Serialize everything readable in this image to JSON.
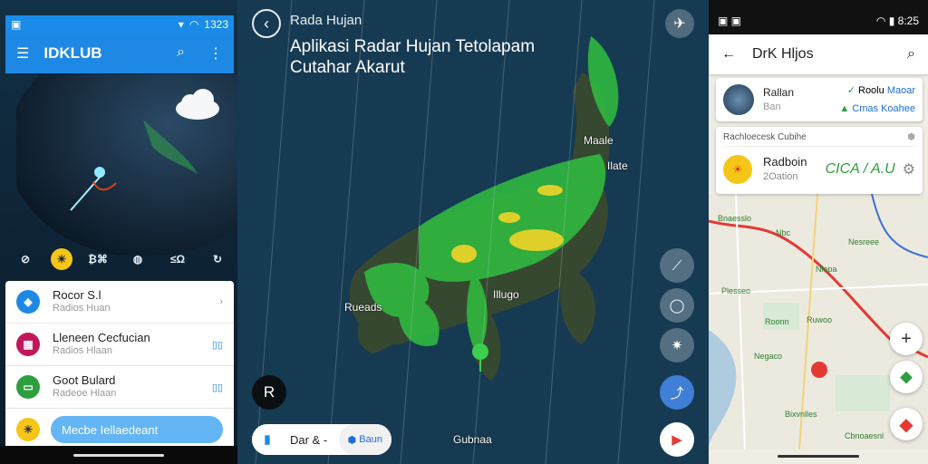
{
  "screen1": {
    "status": {
      "time": "1323"
    },
    "app_title": "IDKLUB",
    "icons_row": [
      "no-rain-icon",
      "sun-icon",
      "stats-icon",
      "globe-icon",
      "wind-icon",
      "rotate-icon"
    ],
    "icon_texts": {
      "stats": "₿⌘",
      "wind": "≤Ω"
    },
    "list": [
      {
        "title": "Rocor S.l",
        "subtitle": "Radios Huan",
        "color": "#1e88e5",
        "icon": "location-icon"
      },
      {
        "title": "Lleneen Cecfucian",
        "subtitle": "Radios Hlaan",
        "color": "#c2185b",
        "icon": "map-icon",
        "end": "▯▯"
      },
      {
        "title": "Goot Bulard",
        "subtitle": "Radeoe Hlaan",
        "color": "#2e9e3e",
        "icon": "tv-icon",
        "end": "▯▯"
      }
    ],
    "action_pill": "Mecbe Iellaedeant"
  },
  "screen2": {
    "small_title": "Rada Hujan",
    "big_title": "Aplikasi Radar Hujan Tetolapam Cutahar Akarut",
    "map_labels": [
      {
        "text": "Maale"
      },
      {
        "text": "Ilate"
      },
      {
        "text": "Rueads"
      },
      {
        "text": "Illugo"
      },
      {
        "text": "Gubnaa"
      }
    ],
    "bottom_bar": {
      "mid": "Dar & -",
      "seg": "Baun"
    },
    "black_fab": "R"
  },
  "screen3": {
    "status": {
      "time": "8:25"
    },
    "title": "DrK Hljos",
    "card1": {
      "name": "Rallan",
      "sub": "Ban",
      "r1a": "Roolu",
      "r1b": "Maoar",
      "r2a": "Cmas",
      "r2b": "Koahee"
    },
    "card2": {
      "header": "Rachloecesk Cubihe",
      "name": "Radboin",
      "sub": "2Oation",
      "temp": "CICA  / A.U"
    },
    "map_labels": [
      "Bnaesslo",
      "Nbc",
      "Nesreee",
      "Nlopa",
      "Plesseo",
      "Roonn",
      "Ruwoo",
      "Negaco",
      "Bixvnlles",
      "Cbnoaesnl"
    ]
  },
  "colors": {
    "primary": "#1e88e5",
    "radar_green": "#2fbf3f",
    "radar_yellow": "#f1d428"
  }
}
